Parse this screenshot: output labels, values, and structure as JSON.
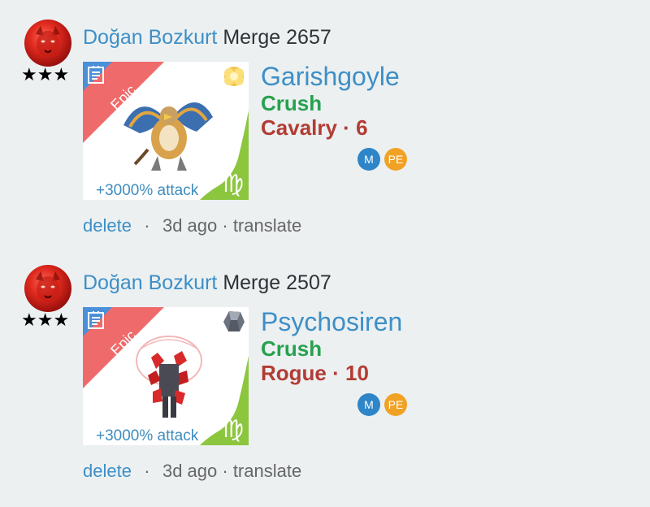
{
  "posts": [
    {
      "user": "Doğan Bozkurt",
      "action": "Merge 2657",
      "stars": "★★★",
      "rarity": "Epic",
      "attack_bonus": "+3000% attack",
      "sign_glyph": "♍",
      "element_icon": "light-element-icon",
      "monster_name": "Garishgoyle",
      "monster_type": "Crush",
      "monster_class": "Cavalry · 6",
      "badges": [
        "M",
        "PE"
      ],
      "delete_label": "delete",
      "separator": "·",
      "time": "3d ago",
      "translate_label": "· translate"
    },
    {
      "user": "Doğan Bozkurt",
      "action": "Merge 2507",
      "stars": "★★★",
      "rarity": "Epic",
      "attack_bonus": "+3000% attack",
      "sign_glyph": "♍",
      "element_icon": "metal-element-icon",
      "monster_name": "Psychosiren",
      "monster_type": "Crush",
      "monster_class": "Rogue · 10",
      "badges": [
        "M",
        "PE"
      ],
      "delete_label": "delete",
      "separator": "·",
      "time": "3d ago",
      "translate_label": "· translate"
    }
  ],
  "colors": {
    "background": "#ecf0f1",
    "link": "#3d8fc7",
    "type_green": "#27a14f",
    "class_red": "#b23c34",
    "epic_ribbon": "#ef6b6b",
    "sign_green": "#8cc63f",
    "badge_m": "#2e85c8",
    "badge_pe": "#f1a224"
  }
}
